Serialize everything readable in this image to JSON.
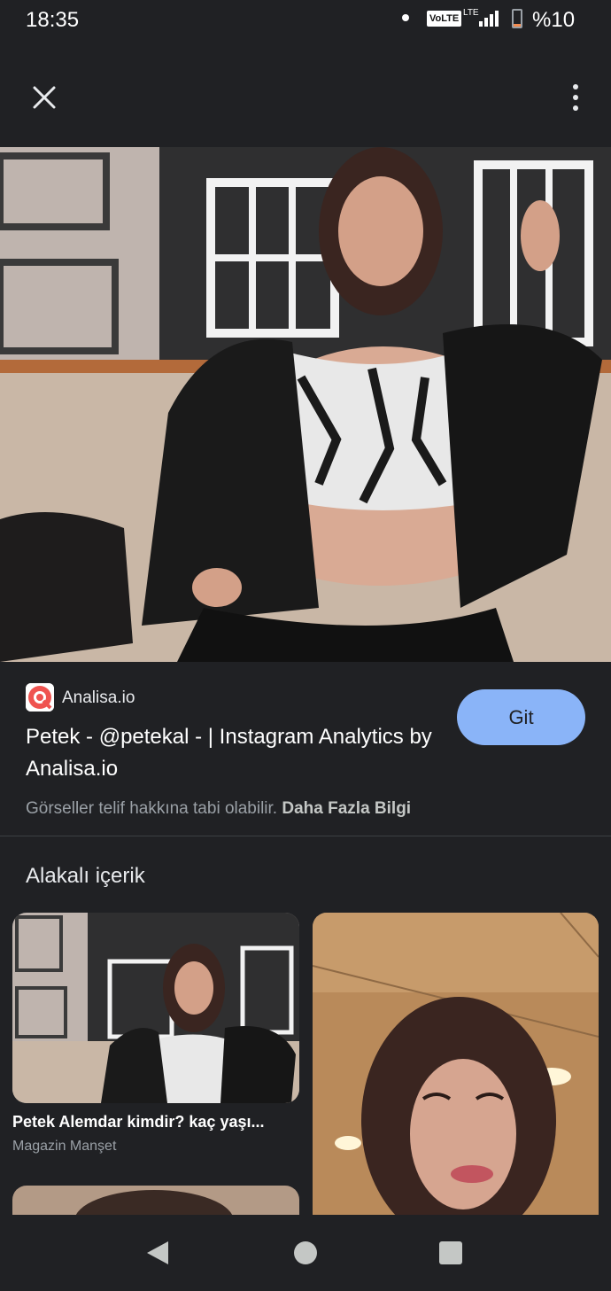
{
  "status_bar": {
    "time": "18:35",
    "network": "VoLTE",
    "network_type": "LTE",
    "battery": "%10",
    "battery_level": 0.1
  },
  "app_bar": {
    "close_icon": "close-icon",
    "more_icon": "more-vert-icon"
  },
  "result": {
    "source_name": "Analisa.io",
    "source_logo_icon": "analisa-logo-icon",
    "title": "Petek - @petekal - | Instagram Analytics by Analisa.io",
    "visit_label": "Git",
    "copyright_text": "Görseller telif hakkına tabi olabilir.",
    "learn_more": "Daha Fazla Bilgi"
  },
  "related": {
    "heading": "Alakalı içerik",
    "items": [
      {
        "title": "Petek Alemdar kimdir? kaç yaşı...",
        "source": "Magazin Manşet"
      }
    ]
  },
  "nav_bar": {
    "back_icon": "back-icon",
    "home_icon": "home-icon",
    "recents_icon": "recents-icon"
  },
  "colors": {
    "background": "#202124",
    "accent_button": "#8ab4f8",
    "secondary_text": "#9aa0a6"
  }
}
